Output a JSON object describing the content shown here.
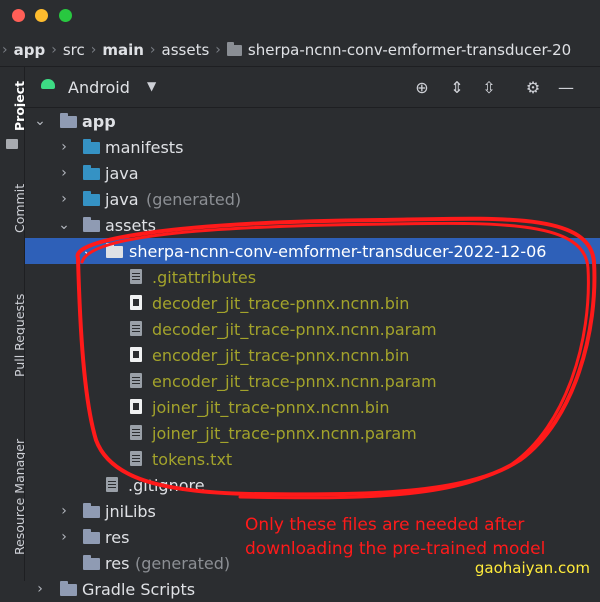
{
  "breadcrumb": {
    "items": [
      "app",
      "src",
      "main",
      "assets",
      "sherpa-ncnn-conv-emformer-transducer-20"
    ]
  },
  "left_strip": {
    "tabs": [
      "Project",
      "Commit",
      "Pull Requests",
      "Resource Manager"
    ]
  },
  "toolbar": {
    "view_label": "Android"
  },
  "tree": {
    "app": "app",
    "manifests": "manifests",
    "java": "java",
    "java_generated_name": "java",
    "java_generated_suffix": "(generated)",
    "assets": "assets",
    "model_folder": "sherpa-ncnn-conv-emformer-transducer-2022-12-06",
    "files": [
      ".gitattributes",
      "decoder_jit_trace-pnnx.ncnn.bin",
      "decoder_jit_trace-pnnx.ncnn.param",
      "encoder_jit_trace-pnnx.ncnn.bin",
      "encoder_jit_trace-pnnx.ncnn.param",
      "joiner_jit_trace-pnnx.ncnn.bin",
      "joiner_jit_trace-pnnx.ncnn.param",
      "tokens.txt"
    ],
    "gitignore": ".gitignore",
    "jniLibs": "jniLibs",
    "res": "res",
    "res_generated_name": "res",
    "res_generated_suffix": "(generated)",
    "gradle_scripts": "Gradle Scripts"
  },
  "annotation": {
    "line1": "Only these files are needed after",
    "line2": "downloading the pre-trained model"
  },
  "watermark": "gaohaiyan.com",
  "colors": {
    "selection": "#2e60b8",
    "ignored_file": "#a3a32b",
    "annotation": "#ff1a1a",
    "watermark": "#ffeb3b"
  }
}
